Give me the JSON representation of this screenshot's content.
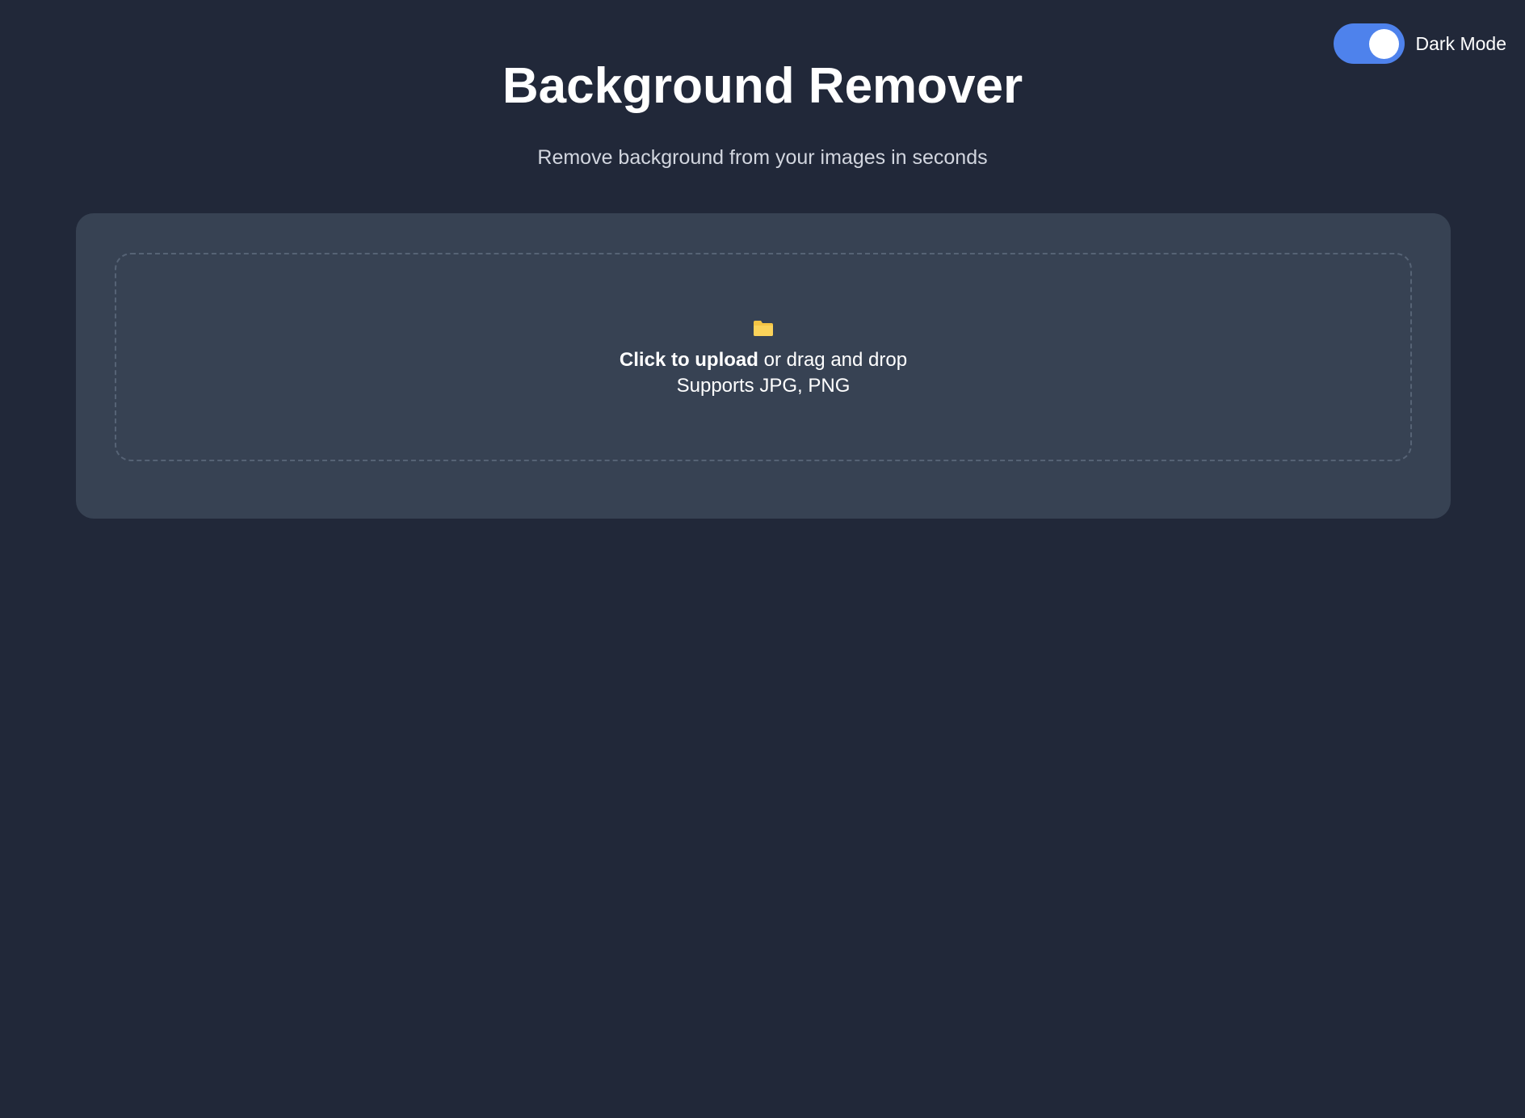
{
  "header": {
    "title": "Background Remover",
    "subtitle": "Remove background from your images in seconds"
  },
  "theme_toggle": {
    "label": "Dark Mode",
    "enabled": true,
    "accent_color": "#4e82ec"
  },
  "upload": {
    "icon": "folder-icon",
    "action_label": "Click to upload",
    "action_suffix": " or drag and drop",
    "supported_formats": "Supports JPG, PNG"
  },
  "colors": {
    "background": "#212839",
    "card": "#374253",
    "folder": "#f5c544"
  }
}
